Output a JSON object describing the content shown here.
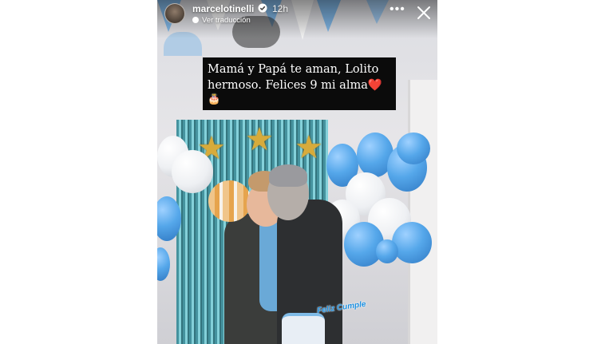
{
  "story": {
    "username": "marcelotinelli",
    "time": "12h",
    "translate_label": "Ver traducción",
    "caption_lines": [
      "Mamá y Papá te aman, Lolito",
      "hermoso. Felices 9 mi alma"
    ],
    "caption_heart": "❤️",
    "caption_cake": "🎂",
    "more_symbol": "•••",
    "cake_topper_text": "Feliz Cumple"
  },
  "icons": {
    "verified": "verified-badge-icon",
    "more": "more-options-icon",
    "close": "close-icon",
    "translate": "translate-dot-icon"
  },
  "colors": {
    "caption_background": "#0b0b0b",
    "caption_text": "#ffffff",
    "heart": "#e0242e",
    "balloon_blue": "#55a7ea",
    "curtain": "#3d8f9b"
  }
}
